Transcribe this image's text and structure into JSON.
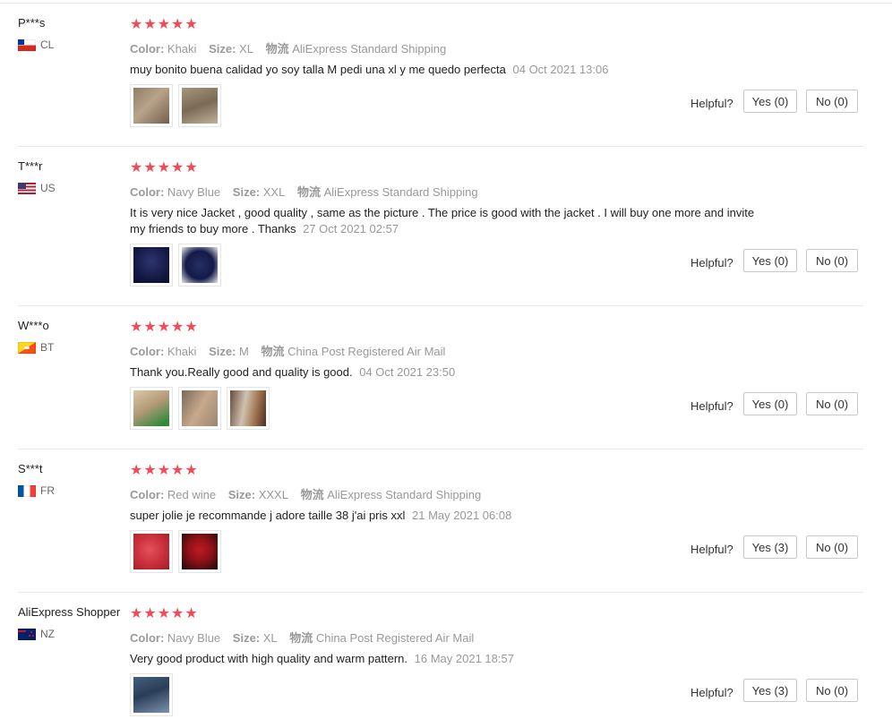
{
  "labels": {
    "color": "Color:",
    "size": "Size:",
    "shipping_prefix": "物流",
    "helpful": "Helpful?"
  },
  "stars": "★★★★★",
  "colors": {
    "star": "#f34a57",
    "meta_gray": "#999999",
    "divider": "#e8e8e8"
  },
  "reviews": [
    {
      "user": "P***s",
      "country": "CL",
      "flag_icon": "chile-flag-icon",
      "rating": 5,
      "color": "Khaki",
      "size": "XL",
      "shipping": "AliExpress Standard Shipping",
      "text": "muy bonito buena calidad yo soy talla M pedi una xl y me quedo perfecta",
      "date": "04 Oct 2021 13:06",
      "yes": "Yes (0)",
      "no": "No (0)",
      "images": [
        "khaki-jacket-photo",
        "khaki-jacket-photo"
      ]
    },
    {
      "user": "T***r",
      "country": "US",
      "flag_icon": "usa-flag-icon",
      "rating": 5,
      "color": "Navy Blue",
      "size": "XXL",
      "shipping": "AliExpress Standard Shipping",
      "text": "It is very nice Jacket , good quality , same as the picture . The price is good with the jacket . I will buy one more and invite my friends to buy more . Thanks",
      "date": "27 Oct 2021 02:57",
      "yes": "Yes (0)",
      "no": "No (0)",
      "images": [
        "navy-jacket-photo",
        "navy-jacket-photo"
      ]
    },
    {
      "user": "W***o",
      "country": "BT",
      "flag_icon": "bhutan-flag-icon",
      "rating": 5,
      "color": "Khaki",
      "size": "M",
      "shipping": "China Post Registered Air Mail",
      "text": "Thank you.Really good and quality is good.",
      "date": "04 Oct 2021 23:50",
      "yes": "Yes (0)",
      "no": "No (0)",
      "images": [
        "khaki-jacket-photo",
        "khaki-jacket-photo",
        "khaki-jacket-photo"
      ]
    },
    {
      "user": "S***t",
      "country": "FR",
      "flag_icon": "france-flag-icon",
      "rating": 5,
      "color": "Red wine",
      "size": "XXXL",
      "shipping": "AliExpress Standard Shipping",
      "text": "super jolie je recommande j adore taille 38 j'ai pris xxl",
      "date": "21 May 2021 06:08",
      "yes": "Yes (3)",
      "no": "No (0)",
      "images": [
        "red-jacket-photo",
        "red-jacket-photo"
      ]
    },
    {
      "user": "AliExpress Shopper",
      "country": "NZ",
      "flag_icon": "new-zealand-flag-icon",
      "rating": 5,
      "color": "Navy Blue",
      "size": "XL",
      "shipping": "China Post Registered Air Mail",
      "text": "Very good product with high quality and warm pattern.",
      "date": "16 May 2021 18:57",
      "yes": "Yes (3)",
      "no": "No (0)",
      "images": [
        "navy-jacket-photo"
      ]
    }
  ]
}
